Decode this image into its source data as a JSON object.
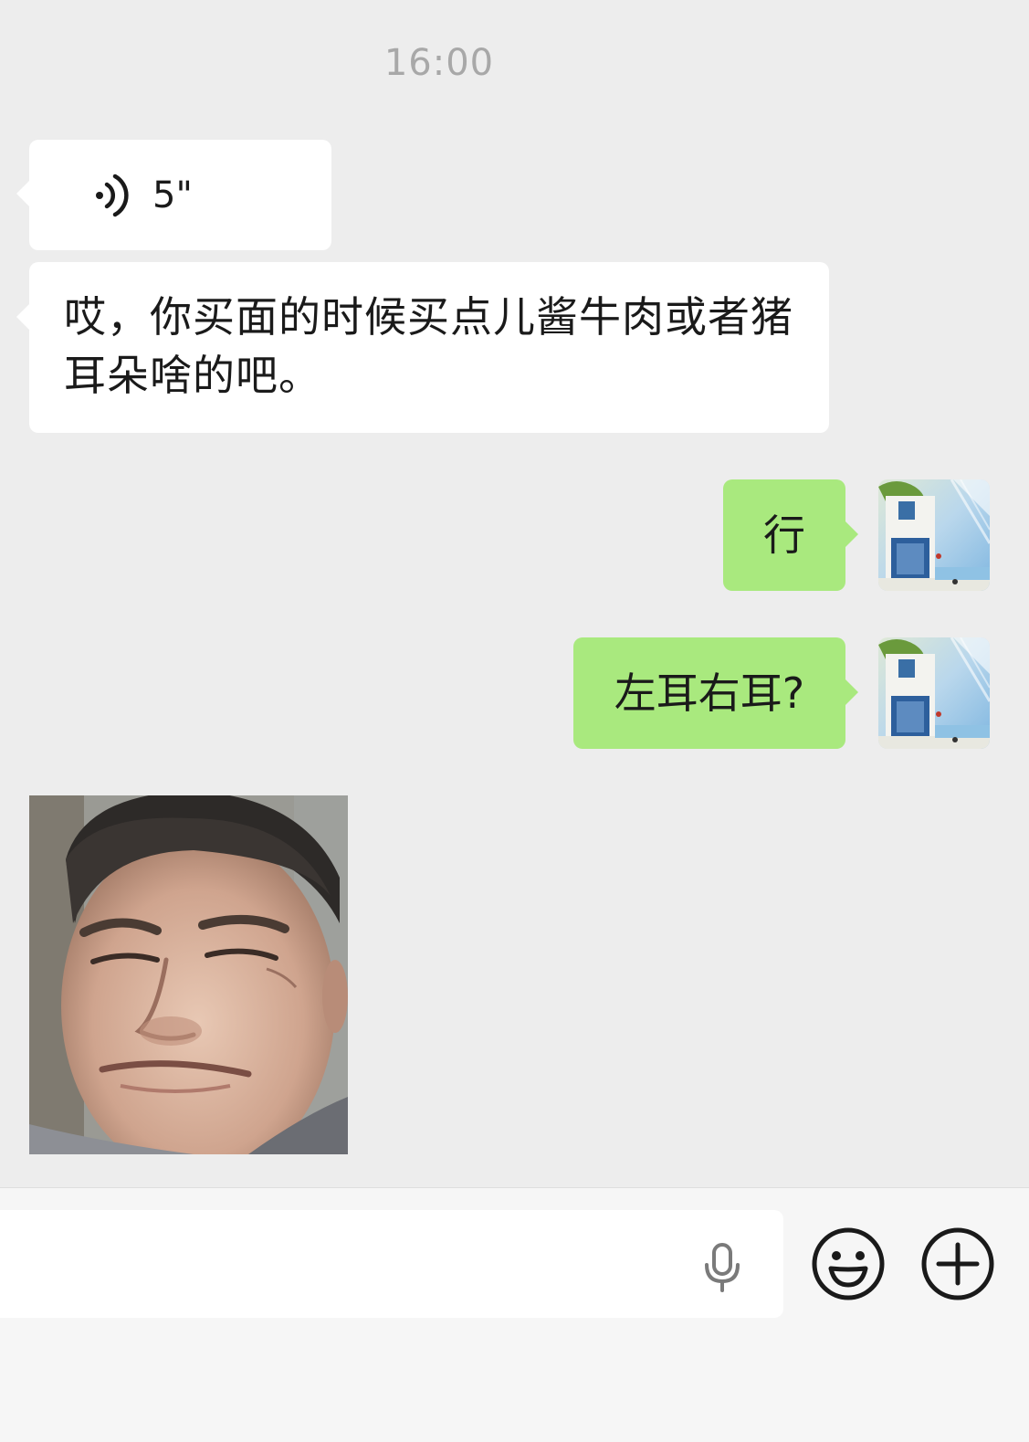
{
  "chat": {
    "timestamp": "16:00",
    "messages": [
      {
        "direction": "incoming",
        "type": "voice",
        "duration": "5\""
      },
      {
        "direction": "incoming",
        "type": "text",
        "text": "哎，你买面的时候买点儿酱牛肉或者猪耳朵啥的吧。"
      },
      {
        "direction": "outgoing",
        "type": "text",
        "text": "行"
      },
      {
        "direction": "outgoing",
        "type": "text",
        "text": "左耳右耳?"
      },
      {
        "direction": "incoming",
        "type": "image",
        "icon": "meme-face-image"
      }
    ]
  },
  "input_bar": {
    "mic_icon": "microphone-icon",
    "emoji_icon": "smiley-face-icon",
    "plus_icon": "plus-circle-icon"
  },
  "colors": {
    "background": "#ededed",
    "incoming_bubble": "#ffffff",
    "outgoing_bubble": "#a9e97e",
    "timestamp": "#a8a8a8",
    "input_bar": "#f6f6f6"
  }
}
